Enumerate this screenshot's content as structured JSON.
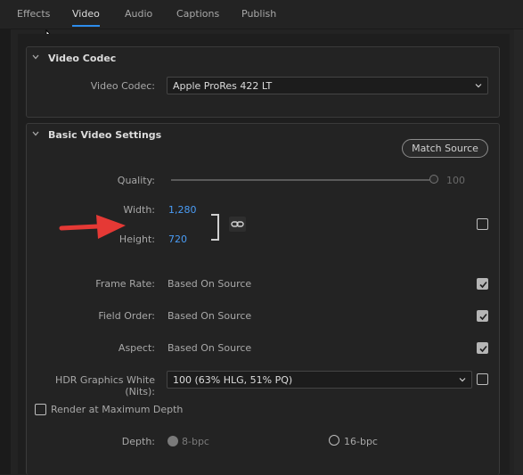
{
  "tabs": [
    "Effects",
    "Video",
    "Audio",
    "Captions",
    "Publish"
  ],
  "active_tab": "Video",
  "video_codec_section": {
    "title": "Video Codec",
    "codec_label": "Video Codec:",
    "codec_value": "Apple ProRes 422 LT"
  },
  "basic_video_section": {
    "title": "Basic Video Settings",
    "match_source_label": "Match Source",
    "quality_label": "Quality:",
    "quality_value": "100",
    "width_label": "Width:",
    "width_value": "1,280",
    "height_label": "Height:",
    "height_value": "720",
    "frame_rate_label": "Frame Rate:",
    "frame_rate_value": "Based On Source",
    "field_order_label": "Field Order:",
    "field_order_value": "Based On Source",
    "aspect_label": "Aspect:",
    "aspect_value": "Based On Source",
    "hdr_label": "HDR Graphics White (Nits):",
    "hdr_value": "100 (63% HLG, 51% PQ)",
    "render_max_depth_label": "Render at Maximum Depth",
    "depth_label": "Depth:",
    "depth_8": "8-bpc",
    "depth_16": "16-bpc"
  },
  "colors": {
    "accent": "#2d8ceb",
    "value_blue": "#4a9cf5",
    "annotation_arrow": "#e53935"
  },
  "icons": [
    "chevron-down-icon",
    "link-icon",
    "checkmark-icon",
    "mouse-cursor-icon",
    "red-arrow-annotation"
  ]
}
